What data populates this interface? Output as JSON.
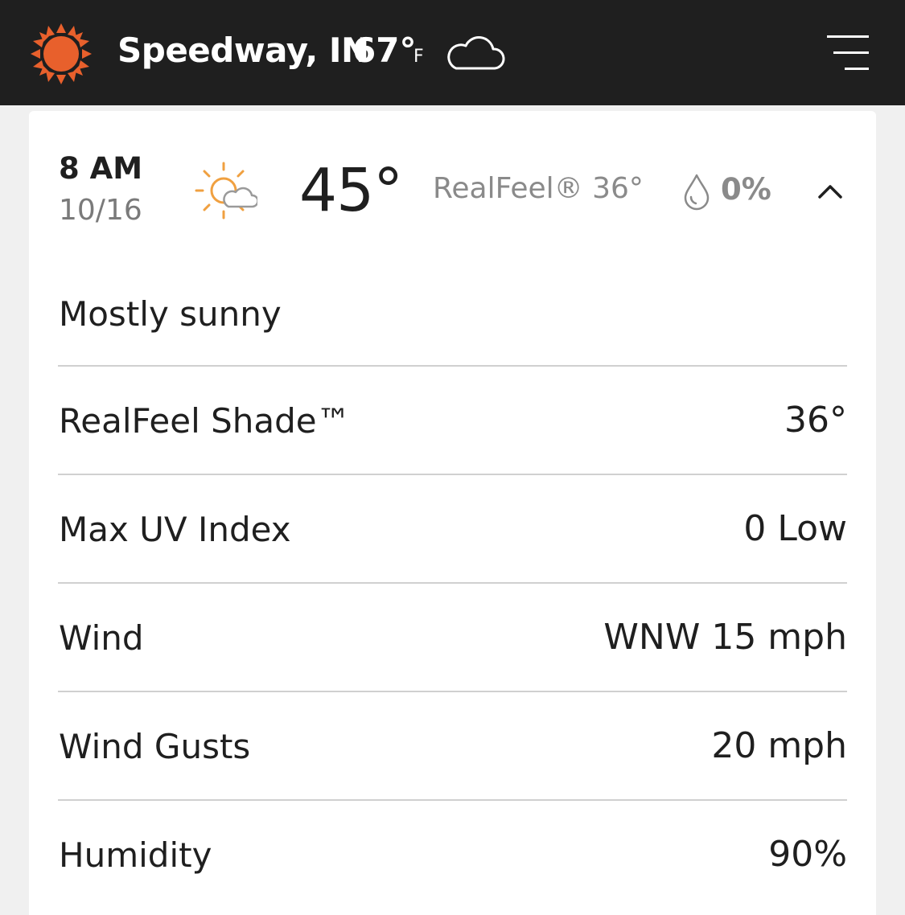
{
  "header": {
    "location": "Speedway, IN",
    "current_temp": "67°",
    "unit": "F",
    "logo_icon": "sun-logo-icon",
    "condition_icon": "cloud-icon",
    "menu_icon": "hamburger-menu-icon",
    "bar_color": "#1f1f1f",
    "logo_color": "#e8602c"
  },
  "hour": {
    "time": "8 AM",
    "date": "10/16",
    "icon": "mostly-sunny-icon",
    "temp": "45°",
    "realfeel": "RealFeel® 36°",
    "precip_icon": "raindrop-icon",
    "precip": "0%",
    "collapse_icon": "chevron-up-icon",
    "phrase": "Mostly sunny"
  },
  "details": [
    {
      "label": "RealFeel Shade™",
      "value": "36°"
    },
    {
      "label": "Max UV Index",
      "value": "0 Low"
    },
    {
      "label": "Wind",
      "value": "WNW 15 mph"
    },
    {
      "label": "Wind Gusts",
      "value": "20 mph"
    },
    {
      "label": "Humidity",
      "value": "90%"
    }
  ]
}
